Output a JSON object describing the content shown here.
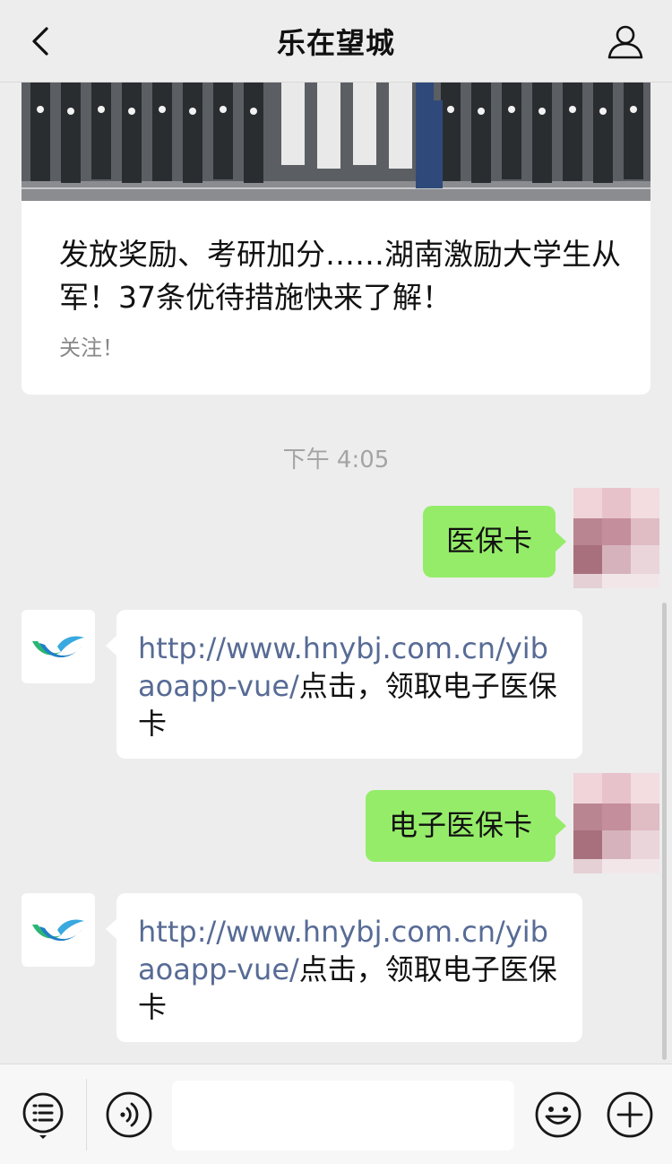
{
  "header": {
    "title": "乐在望城",
    "back_icon": "chevron-left-icon",
    "profile_icon": "person-icon"
  },
  "article": {
    "headline": "发放奖励、考研加分……湖南激励大学生从军！37条优待措施快来了解！",
    "summary": "关注！"
  },
  "timestamp": "下午 4:05",
  "messages": [
    {
      "from": "me",
      "text": "医保卡"
    },
    {
      "from": "bot",
      "link": "http://www.hnybj.com.cn/yibaoapp-vue/",
      "text": "点击，领取电子医保卡"
    },
    {
      "from": "me",
      "text": "电子医保卡"
    },
    {
      "from": "bot",
      "link": "http://www.hnybj.com.cn/yibaoapp-vue/",
      "text": "点击，领取电子医保卡"
    }
  ],
  "toolbar": {
    "menu_icon": "list-menu-icon",
    "voice_icon": "voice-icon",
    "emoji_icon": "smiley-icon",
    "add_icon": "plus-icon"
  },
  "colors": {
    "background": "#ededed",
    "my_bubble": "#95ec69",
    "link": "#576b95"
  }
}
